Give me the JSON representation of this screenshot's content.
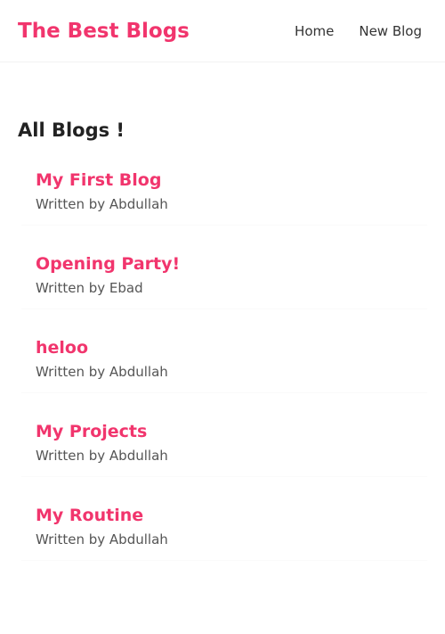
{
  "navbar": {
    "brand": "The Best Blogs",
    "links": [
      "Home",
      "New Blog"
    ]
  },
  "main": {
    "heading": "All Blogs !",
    "blogs": [
      {
        "title": "My First Blog",
        "author": "Written by Abdullah"
      },
      {
        "title": "Opening Party!",
        "author": "Written by Ebad"
      },
      {
        "title": "heloo",
        "author": "Written by Abdullah"
      },
      {
        "title": "My Projects",
        "author": "Written by Abdullah"
      },
      {
        "title": "My Routine",
        "author": "Written by Abdullah"
      }
    ]
  },
  "colors": {
    "accent": "#f1356d",
    "heading": "#222222",
    "text": "#555555"
  }
}
